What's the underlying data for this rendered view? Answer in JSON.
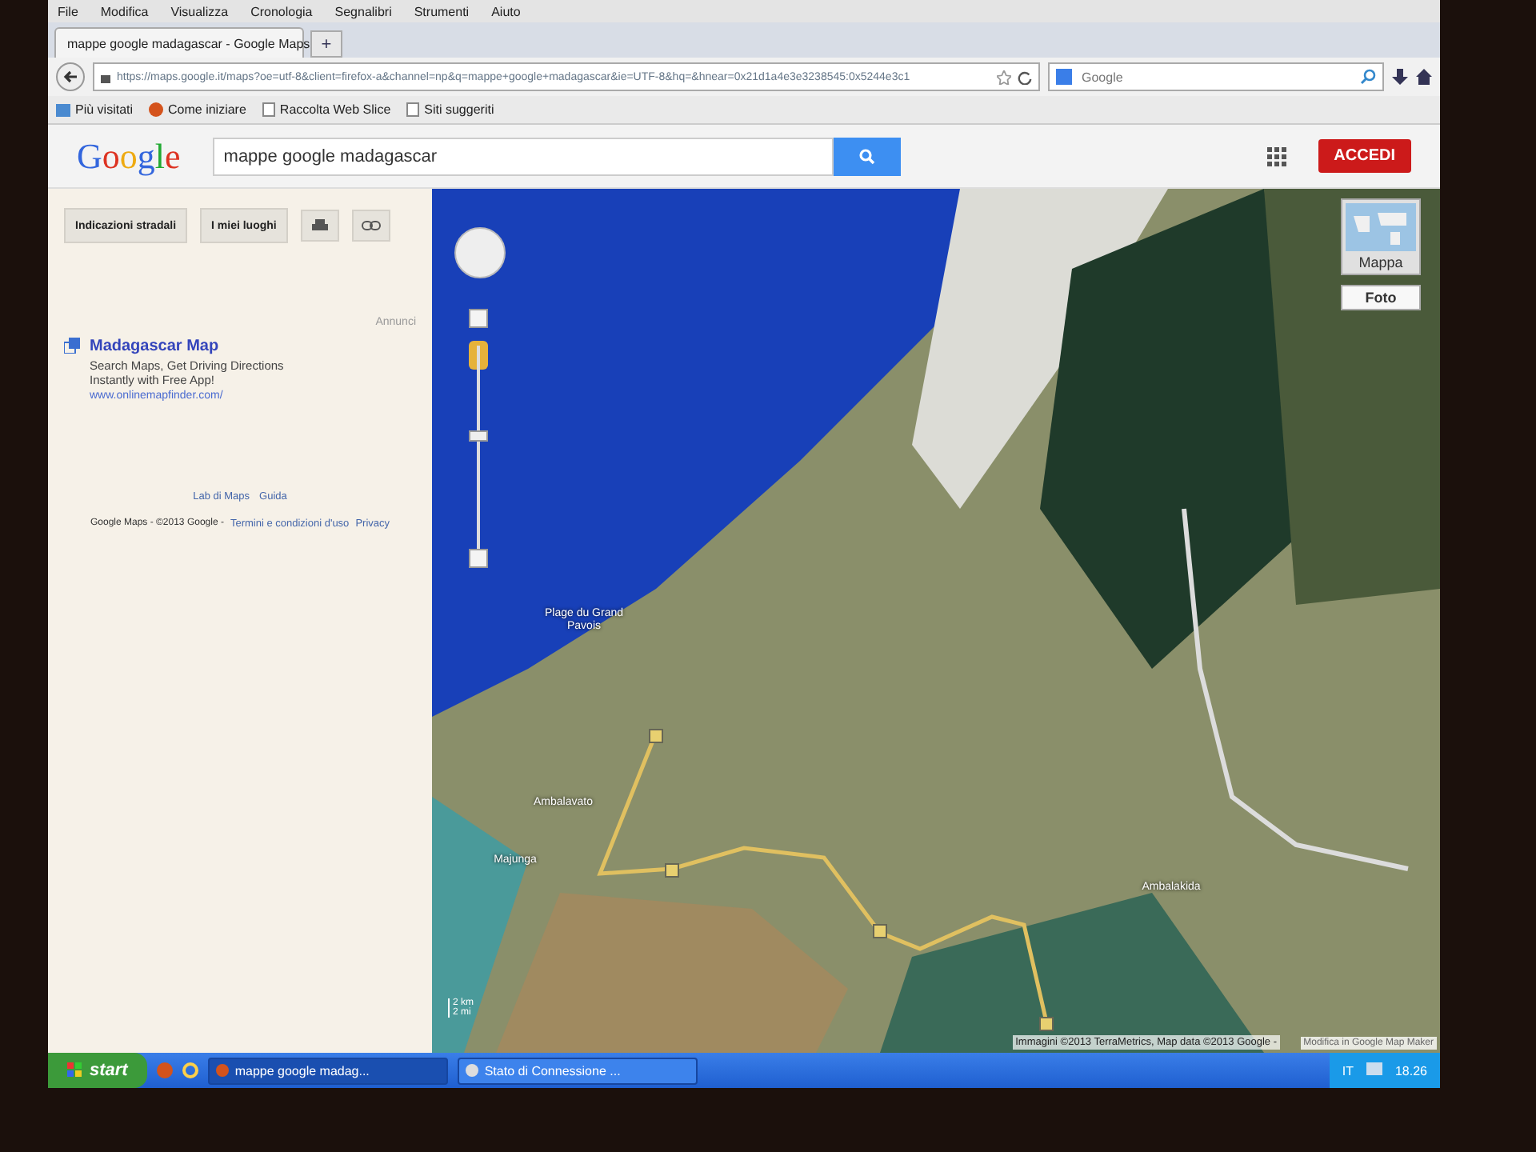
{
  "browser": {
    "menu": [
      "File",
      "Modifica",
      "Visualizza",
      "Cronologia",
      "Segnalibri",
      "Strumenti",
      "Aiuto"
    ],
    "tabs": [
      {
        "label": "mappe google madagascar - Google Maps",
        "selected": true
      }
    ],
    "new_tab": "+",
    "url": "https://maps.google.it/maps?oe=utf-8&client=firefox-a&channel=np&q=mappe+google+madagascar&ie=UTF-8&hq=&hnear=0x21d1a4e3e3238545:0x5244e3c1",
    "search": {
      "placeholder": "Google"
    },
    "bookmarks": [
      {
        "label": "Più visitati",
        "kind": "folder"
      },
      {
        "label": "Come iniziare",
        "kind": "firefox"
      },
      {
        "label": "Raccolta Web Slice",
        "kind": "page"
      },
      {
        "label": "Siti suggeriti",
        "kind": "page"
      }
    ]
  },
  "header": {
    "logo": "Google",
    "query": "mappe google madagascar",
    "sign_in": "ACCEDI"
  },
  "sidebar": {
    "buttons": [
      "Indicazioni stradali",
      "I miei luoghi"
    ],
    "ad": {
      "label": "Annunci",
      "title": "Madagascar Map",
      "text": "Search Maps, Get Driving Directions Instantly with Free App!",
      "url": "www.onlinemapfinder.com/"
    },
    "links": [
      "Lab di Maps",
      "Guida"
    ],
    "footer": {
      "text": "Google Maps - ©2013 Google -",
      "links": [
        "Termini e condizioni d'uso",
        "Privacy"
      ]
    }
  },
  "map": {
    "zoom": {
      "level": 0.57
    },
    "types": [
      {
        "label": "Mappa",
        "selected": false
      },
      {
        "label": "Foto",
        "selected": true
      }
    ],
    "places": [
      {
        "name": "Plage du Grand Pavois"
      },
      {
        "name": "Ambalavato"
      },
      {
        "name": "Majunga"
      },
      {
        "name": "Ambalakida"
      }
    ],
    "scale": [
      "2 km",
      "2 mi"
    ],
    "attribution": "Immagini ©2013 TerraMetrics, Map data ©2013 Google -",
    "edit_link": "Modifica in Google Map Maker"
  },
  "taskbar": {
    "start": "start",
    "windows": [
      {
        "label": "mappe google madag...",
        "selected": true
      },
      {
        "label": "Stato di Connessione ...",
        "selected": false
      }
    ],
    "language": "IT",
    "clock": "18.26"
  }
}
